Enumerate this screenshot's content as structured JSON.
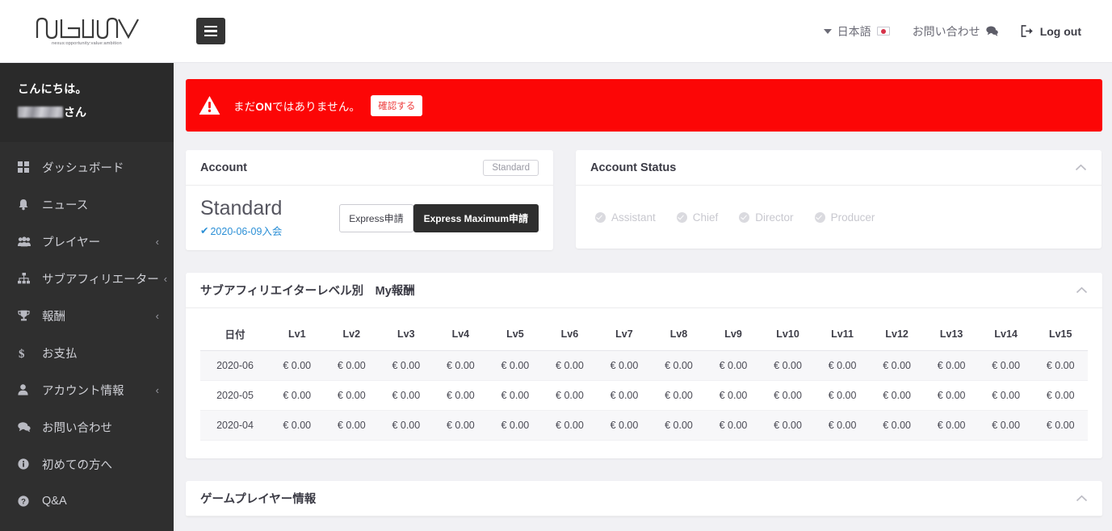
{
  "brand": {
    "logo_text": "NOVA",
    "tagline": "nexus:opportunity:value:ambition"
  },
  "header": {
    "menu_toggle": "menu-toggle",
    "language": "日本語",
    "language_flag": "jp-flag-icon",
    "contact": "お問い合わせ",
    "logout": "Log out"
  },
  "sidebar": {
    "greeting": "こんにちは。",
    "user_suffix": "さん",
    "user_name_redacted": true,
    "items": [
      {
        "label": "ダッシュボード",
        "icon": "grid-icon",
        "expandable": false,
        "chevron": ""
      },
      {
        "label": "ニュース",
        "icon": "bell-icon",
        "expandable": false,
        "chevron": ""
      },
      {
        "label": "プレイヤー",
        "icon": "users-icon",
        "expandable": true,
        "chevron": "‹"
      },
      {
        "label": "サブアフィリエーター",
        "icon": "sitemap-icon",
        "expandable": true,
        "chevron": "‹"
      },
      {
        "label": "報酬",
        "icon": "trophy-icon",
        "expandable": true,
        "chevron": "‹"
      },
      {
        "label": "お支払",
        "icon": "dollar-icon",
        "expandable": false,
        "chevron": ""
      },
      {
        "label": "アカウント情報",
        "icon": "user-icon",
        "expandable": true,
        "chevron": "‹"
      },
      {
        "label": "お問い合わせ",
        "icon": "chat-icon",
        "expandable": false,
        "chevron": ""
      },
      {
        "label": "初めての方へ",
        "icon": "info-icon",
        "expandable": false,
        "chevron": ""
      },
      {
        "label": "Q&A",
        "icon": "question-icon",
        "expandable": false,
        "chevron": ""
      }
    ]
  },
  "alert": {
    "icon": "warning-triangle-icon",
    "text_pre": "まだ",
    "text_bold": "ON",
    "text_post": "ではありません。",
    "button": "確認する",
    "bg_color": "#fc0606"
  },
  "account_card": {
    "title": "Account",
    "badge": "Standard",
    "plan": "Standard",
    "join_check": "✔",
    "join_date": "2020-06-09入会",
    "join_color": "#2b8fd6",
    "btn_express": "Express申請",
    "btn_express_max": "Express Maximum申請"
  },
  "account_status_card": {
    "title": "Account Status",
    "collapse_icon": "chevron-up-icon",
    "statuses": [
      {
        "label": "Assistant",
        "active": false
      },
      {
        "label": "Chief",
        "active": false
      },
      {
        "label": "Director",
        "active": false
      },
      {
        "label": "Producer",
        "active": false
      }
    ]
  },
  "reward_table_card": {
    "title": "サブアフィリエイターレベル別　My報酬",
    "collapse_icon": "chevron-up-icon",
    "columns": [
      "日付",
      "Lv1",
      "Lv2",
      "Lv3",
      "Lv4",
      "Lv5",
      "Lv6",
      "Lv7",
      "Lv8",
      "Lv9",
      "Lv10",
      "Lv11",
      "Lv12",
      "Lv13",
      "Lv14",
      "Lv15"
    ],
    "rows": [
      {
        "date": "2020-06",
        "values": [
          "€ 0.00",
          "€ 0.00",
          "€ 0.00",
          "€ 0.00",
          "€ 0.00",
          "€ 0.00",
          "€ 0.00",
          "€ 0.00",
          "€ 0.00",
          "€ 0.00",
          "€ 0.00",
          "€ 0.00",
          "€ 0.00",
          "€ 0.00",
          "€ 0.00"
        ]
      },
      {
        "date": "2020-05",
        "values": [
          "€ 0.00",
          "€ 0.00",
          "€ 0.00",
          "€ 0.00",
          "€ 0.00",
          "€ 0.00",
          "€ 0.00",
          "€ 0.00",
          "€ 0.00",
          "€ 0.00",
          "€ 0.00",
          "€ 0.00",
          "€ 0.00",
          "€ 0.00",
          "€ 0.00"
        ]
      },
      {
        "date": "2020-04",
        "values": [
          "€ 0.00",
          "€ 0.00",
          "€ 0.00",
          "€ 0.00",
          "€ 0.00",
          "€ 0.00",
          "€ 0.00",
          "€ 0.00",
          "€ 0.00",
          "€ 0.00",
          "€ 0.00",
          "€ 0.00",
          "€ 0.00",
          "€ 0.00",
          "€ 0.00"
        ]
      }
    ]
  },
  "game_player_card": {
    "title": "ゲームプレイヤー情報",
    "collapse_icon": "chevron-up-icon"
  }
}
